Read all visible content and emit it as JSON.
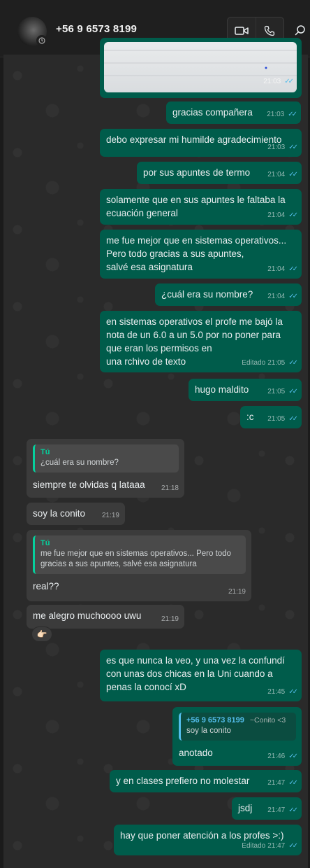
{
  "header": {
    "contact_name": "+56 9 6573 8199",
    "icons": [
      "avatar",
      "status-icon",
      "video-call-icon",
      "voice-call-icon",
      "search-icon"
    ]
  },
  "colors": {
    "outgoing_bubble": "#005c4b",
    "incoming_bubble": "#3b3b3b",
    "read_ticks": "#53bdeb",
    "quote_accent": "#06cf9c"
  },
  "messages": [
    {
      "id": "m0",
      "dir": "out",
      "text": "",
      "time": "21:03",
      "ticks": true,
      "edited": false,
      "image": true
    },
    {
      "id": "m1",
      "dir": "out",
      "text": "gracias compañera",
      "time": "21:03",
      "ticks": true
    },
    {
      "id": "m2",
      "dir": "out",
      "text": "debo expresar mi humilde agradecimiento",
      "time": "21:03",
      "ticks": true
    },
    {
      "id": "m3",
      "dir": "out",
      "text": "por sus apuntes de termo",
      "time": "21:04",
      "ticks": true
    },
    {
      "id": "m4",
      "dir": "out",
      "text": "solamente que en sus apuntes le faltaba la\necuación general",
      "time": "21:04",
      "ticks": true
    },
    {
      "id": "m5",
      "dir": "out",
      "text": "me fue mejor que en sistemas operativos...\nPero todo gracias a sus apuntes,\nsalvé esa asignatura",
      "time": "21:04",
      "ticks": true
    },
    {
      "id": "m6",
      "dir": "out",
      "text": "¿cuál era su nombre?",
      "time": "21:04",
      "ticks": true
    },
    {
      "id": "m7",
      "dir": "out",
      "text": "en sistemas operativos el profe me bajó la\nnota de un 6.0 a un 5.0  por no poner para\nque eran los permisos en\nuna rchivo de texto",
      "time": "21:05",
      "ticks": true,
      "edited_label": "Editado"
    },
    {
      "id": "m8",
      "dir": "out",
      "text": "hugo maldito",
      "time": "21:05",
      "ticks": true
    },
    {
      "id": "m9",
      "dir": "out",
      "text": ":c",
      "time": "21:05",
      "ticks": true
    },
    {
      "id": "m10",
      "dir": "in",
      "text": "siempre te olvidas q lataaa",
      "time": "21:18",
      "quote": {
        "name": "Tú",
        "text": "¿cuál era su nombre?"
      }
    },
    {
      "id": "m11",
      "dir": "in",
      "text": "soy la conito",
      "time": "21:19"
    },
    {
      "id": "m12",
      "dir": "in",
      "text": "real??",
      "time": "21:19",
      "quote": {
        "name": "Tú",
        "text": "me fue mejor que en sistemas operativos... Pero todo\ngracias a sus apuntes, salvé esa asignatura"
      }
    },
    {
      "id": "m13",
      "dir": "in",
      "text": "me alegro muchoooo uwu",
      "time": "21:19",
      "reaction": "👉🏻"
    },
    {
      "id": "m14",
      "dir": "out",
      "text": "es que nunca la veo, y una vez la confundí\ncon unas dos chicas en la Uni cuando a\npenas la conocí  xD",
      "time": "21:45",
      "ticks": true
    },
    {
      "id": "m15",
      "dir": "out",
      "text": "anotado",
      "time": "21:46",
      "ticks": true,
      "quote": {
        "name": "+56 9 6573 8199",
        "alias": "~Conito <3",
        "text": "soy la conito"
      }
    },
    {
      "id": "m16",
      "dir": "out",
      "text": "y en clases prefiero no molestar",
      "time": "21:47",
      "ticks": true
    },
    {
      "id": "m17",
      "dir": "out",
      "text": "jsdj",
      "time": "21:47",
      "ticks": true
    },
    {
      "id": "m18",
      "dir": "out",
      "text": "hay que poner atención a los profes >:)",
      "time": "21:47",
      "ticks": true,
      "edited_label": "Editado"
    }
  ]
}
